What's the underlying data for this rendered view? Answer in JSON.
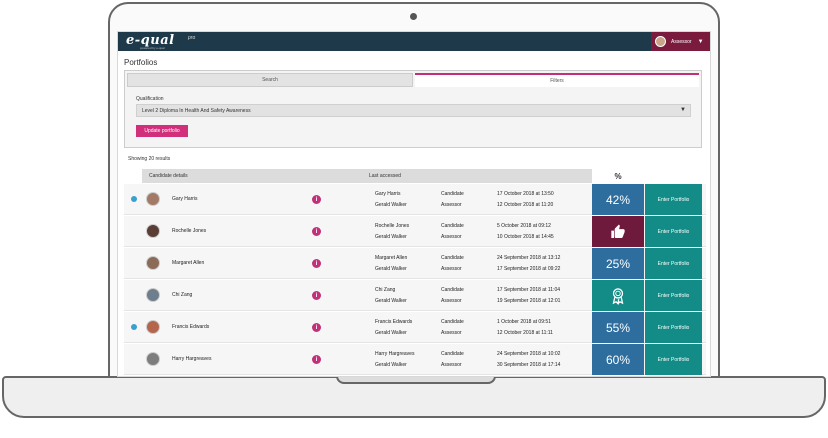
{
  "header": {
    "logo": "e-qual",
    "logo_sup": "pro",
    "logo_tag": "powered by e-qual",
    "user_name": "Assessor",
    "user_caret": "▼"
  },
  "page": {
    "title": "Portfolios"
  },
  "filters": {
    "tab_search": "Search",
    "tab_filters": "Filters",
    "qualification_label": "Qualification",
    "qualification_value": "Level 2 Diploma In Health And Safety Awareness",
    "update_button": "Update portfolio"
  },
  "results": {
    "count_text": "Showing 20 results"
  },
  "table": {
    "headers": {
      "candidate": "Candidate details",
      "last_accessed": "Last accessed",
      "percent": "%"
    },
    "rows": [
      {
        "status_dot": true,
        "name": "Gary Harris",
        "accessed_by": [
          "Gary Harris",
          "Gerald Walker"
        ],
        "roles": [
          "Candidate",
          "Assessor"
        ],
        "dates": [
          "17 October 2018 at 13:50",
          "12 October 2018 at 11:20"
        ],
        "progress": "42%",
        "progress_type": "percent",
        "enter_label": "Enter Portfolio"
      },
      {
        "status_dot": false,
        "name": "Rochelle Jones",
        "accessed_by": [
          "Rochelle Jones",
          "Gerald Walker"
        ],
        "roles": [
          "Candidate",
          "Assessor"
        ],
        "dates": [
          "5 October 2018 at 09:12",
          "10 October 2018 at 14:45"
        ],
        "progress": "",
        "progress_type": "thumbs-up",
        "enter_label": "Enter Portfolio"
      },
      {
        "status_dot": false,
        "name": "Margaret Allen",
        "accessed_by": [
          "Margaret Allen",
          "Gerald Walker"
        ],
        "roles": [
          "Candidate",
          "Assessor"
        ],
        "dates": [
          "24 September 2018 at 13:12",
          "17 September 2018 at 09:22"
        ],
        "progress": "25%",
        "progress_type": "percent",
        "enter_label": "Enter Portfolio"
      },
      {
        "status_dot": false,
        "name": "Chi Zang",
        "accessed_by": [
          "Chi Zang",
          "Gerald Walker"
        ],
        "roles": [
          "Candidate",
          "Assessor"
        ],
        "dates": [
          "17 September 2018 at 11:04",
          "19 September 2018 at 12:01"
        ],
        "progress": "",
        "progress_type": "award",
        "enter_label": "Enter Portfolio"
      },
      {
        "status_dot": true,
        "name": "Francis Edwards",
        "accessed_by": [
          "Francis Edwards",
          "Gerald Walker"
        ],
        "roles": [
          "Candidate",
          "Assessor"
        ],
        "dates": [
          "1 October 2018 at 09:51",
          "12 October 2018 at 11:11"
        ],
        "progress": "55%",
        "progress_type": "percent",
        "enter_label": "Enter Portfolio"
      },
      {
        "status_dot": false,
        "name": "Harry Hargreaves",
        "accessed_by": [
          "Harry Hargreaves",
          "Gerald Walker"
        ],
        "roles": [
          "Candidate",
          "Assessor"
        ],
        "dates": [
          "24 September 2018 at 10:02",
          "30 September 2018 at 17:14"
        ],
        "progress": "60%",
        "progress_type": "percent",
        "enter_label": "Enter Portfolio"
      }
    ]
  },
  "colors": {
    "header_bg": "#1e3a4a",
    "user_menu_bg": "#7a1b3d",
    "accent_pink": "#c2307a",
    "percent_blue": "#2e6e9e",
    "teal": "#138b86",
    "thumb_maroon": "#6e1a3c"
  }
}
